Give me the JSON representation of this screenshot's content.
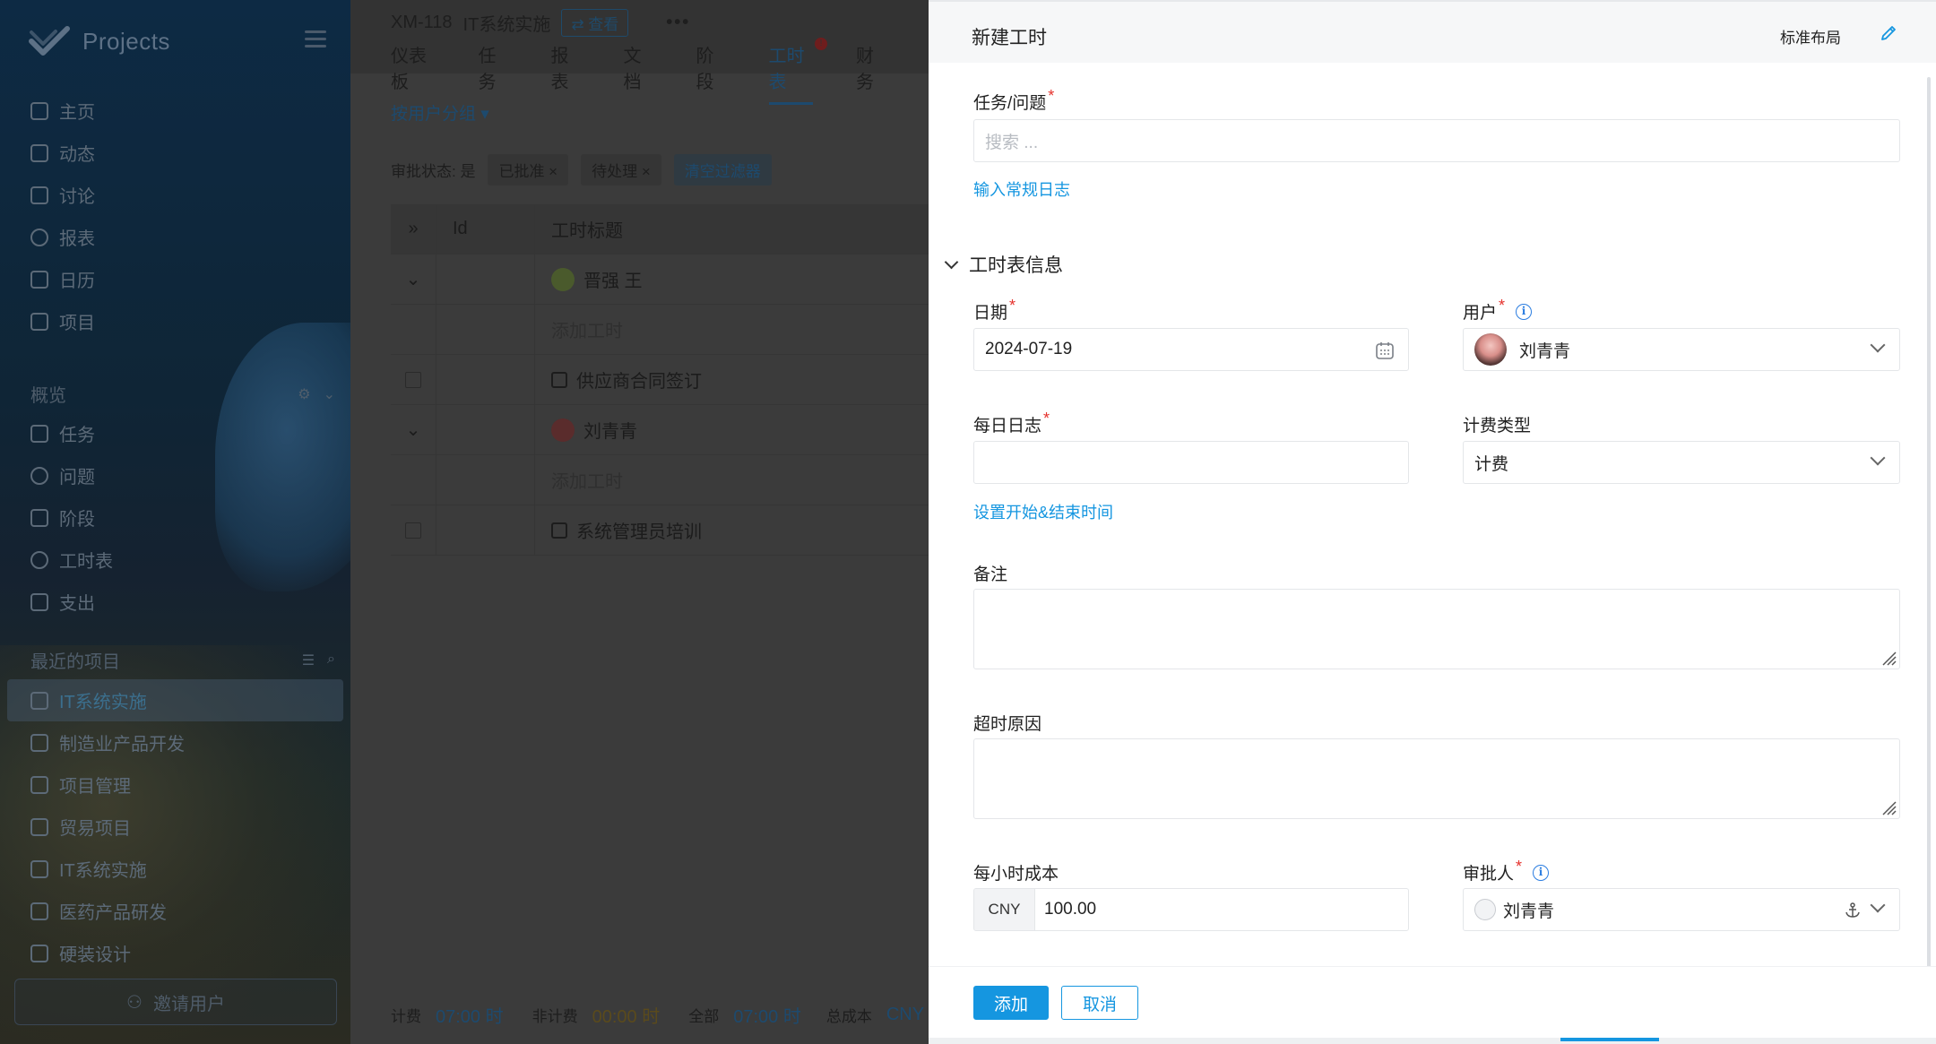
{
  "sidebar": {
    "brand": "Projects",
    "primary": [
      "主页",
      "动态",
      "讨论",
      "报表",
      "日历",
      "项目"
    ],
    "overview_label": "概览",
    "overview": [
      "任务",
      "问题",
      "阶段",
      "工时表",
      "支出"
    ],
    "recent_label": "最近的项目",
    "recent": [
      "IT系统实施",
      "制造业产品开发",
      "项目管理",
      "贸易项目",
      "IT系统实施",
      "医药产品研发",
      "硬装设计"
    ],
    "invite_label": "邀请用户"
  },
  "main": {
    "project_id": "XM-118",
    "project_name": "IT系统实施",
    "view_label": "查看",
    "more": "•••",
    "tabs": [
      "仪表板",
      "任务",
      "报表",
      "文档",
      "阶段",
      "工时表",
      "财务"
    ],
    "active_tab": "工时表",
    "tab_badge": "!",
    "group_by": "按用户分组",
    "filter_label": "审批状态: 是",
    "filter_chips": [
      "已批准",
      "待处理"
    ],
    "clear_filters": "清空过滤器",
    "table_head": {
      "id": "Id",
      "title": "工时标题"
    },
    "rows": [
      {
        "type": "group",
        "title": "晋强 王"
      },
      {
        "type": "placeholder",
        "title": "添加工时"
      },
      {
        "type": "task",
        "title": "供应商合同签订"
      },
      {
        "type": "group",
        "title": "刘青青"
      },
      {
        "type": "placeholder",
        "title": "添加工时"
      },
      {
        "type": "task",
        "title": "系统管理员培训"
      }
    ],
    "footer": {
      "billable_label": "计费",
      "billable_value": "07:00 时",
      "nonbillable_label": "非计费",
      "nonbillable_value": "00:00 时",
      "total_label": "全部",
      "total_value": "07:00 时",
      "cost_label": "总成本",
      "cost_value": "CNY"
    }
  },
  "drawer": {
    "title": "新建工时",
    "layout_label": "标准布局",
    "task_label": "任务/问题",
    "task_placeholder": "搜索 ...",
    "regular_log_link": "输入常规日志",
    "section_title": "工时表信息",
    "date_label": "日期",
    "date_value": "2024-07-19",
    "user_label": "用户",
    "user_value": "刘青青",
    "daily_log_label": "每日日志",
    "billing_type_label": "计费类型",
    "billing_type_value": "计费",
    "set_time_link": "设置开始&结束时间",
    "notes_label": "备注",
    "overtime_label": "超时原因",
    "hourly_cost_label": "每小时成本",
    "currency": "CNY",
    "hourly_cost_value": "100.00",
    "approver_label": "审批人",
    "approver_value": "刘青青",
    "info_glyph": "i",
    "req_mark": "*",
    "add_button": "添加",
    "cancel_button": "取消"
  }
}
